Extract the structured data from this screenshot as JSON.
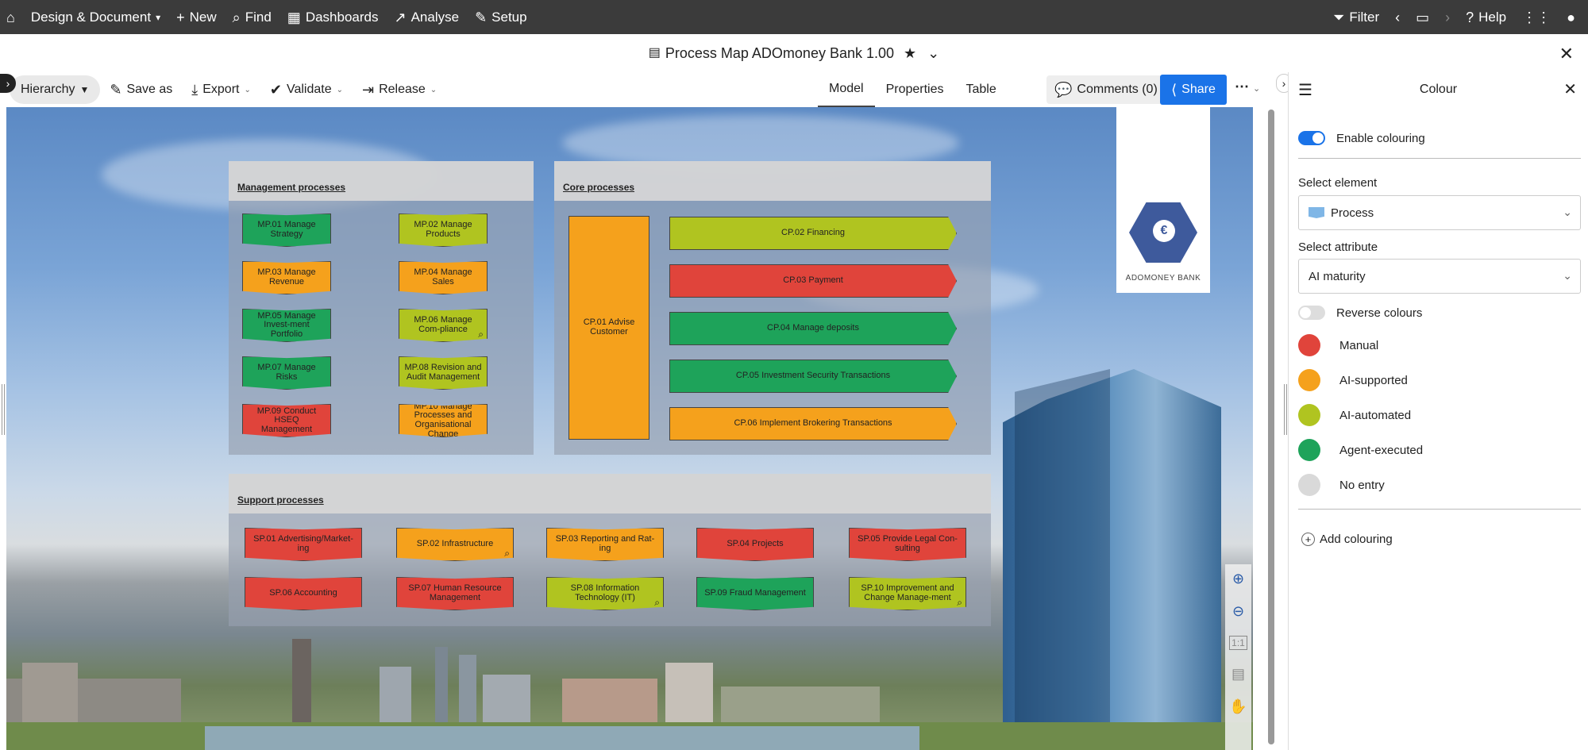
{
  "topbar": {
    "home_icon": "home-icon",
    "menu": [
      {
        "label": "Design & Document",
        "icon": "",
        "caret": true
      },
      {
        "label": "New",
        "icon": "plus-icon"
      },
      {
        "label": "Find",
        "icon": "search-icon"
      },
      {
        "label": "Dashboards",
        "icon": "dashboard-icon"
      },
      {
        "label": "Analyse",
        "icon": "chart-icon"
      },
      {
        "label": "Setup",
        "icon": "wrench-icon"
      }
    ],
    "right": {
      "filter": "Filter",
      "help": "Help"
    }
  },
  "title": {
    "text": "Process Map ADOmoney Bank 1.00"
  },
  "toolbar": {
    "hierarchy": "Hierarchy",
    "save_as": "Save as",
    "export": "Export",
    "validate": "Validate",
    "release": "Release",
    "views": [
      "Model",
      "Properties",
      "Table"
    ],
    "active_view": "Model",
    "comments": "Comments (0)",
    "share": "Share"
  },
  "model": {
    "logo_text": "ADOMONEY BANK",
    "management": {
      "title": "Management processes",
      "items": [
        {
          "label": "MP.01 Manage Strategy",
          "color": "g"
        },
        {
          "label": "MP.02 Manage Products",
          "color": "l"
        },
        {
          "label": "MP.03 Manage Revenue",
          "color": "o"
        },
        {
          "label": "MP.04 Manage Sales",
          "color": "o"
        },
        {
          "label": "MP.05 Manage Invest-ment Portfolio",
          "color": "g"
        },
        {
          "label": "MP.06 Manage Com-pliance",
          "color": "l"
        },
        {
          "label": "MP.07 Manage Risks",
          "color": "g"
        },
        {
          "label": "MP.08 Revision and Audit Management",
          "color": "l"
        },
        {
          "label": "MP.09 Conduct HSEQ Management",
          "color": "r"
        },
        {
          "label": "MP.10 Manage Processes and Organisational Change",
          "color": "o"
        }
      ]
    },
    "core": {
      "title": "Core processes",
      "advise": "CP.01 Advise Customer",
      "items": [
        {
          "label": "CP.02 Financing",
          "color": "l"
        },
        {
          "label": "CP.03 Payment",
          "color": "r"
        },
        {
          "label": "CP.04 Manage deposits",
          "color": "g"
        },
        {
          "label": "CP.05 Investment Security Transactions",
          "color": "g"
        },
        {
          "label": "CP.06 Implement Brokering Transactions",
          "color": "o"
        }
      ]
    },
    "support": {
      "title": "Support processes",
      "items": [
        {
          "label": "SP.01 Advertising/Market-ing",
          "color": "r"
        },
        {
          "label": "SP.02 Infrastructure",
          "color": "o"
        },
        {
          "label": "SP.03 Reporting and Rat-ing",
          "color": "o"
        },
        {
          "label": "SP.04 Projects",
          "color": "r"
        },
        {
          "label": "SP.05 Provide Legal Con-sulting",
          "color": "r"
        },
        {
          "label": "SP.06 Accounting",
          "color": "r"
        },
        {
          "label": "SP.07 Human Resource Management",
          "color": "r"
        },
        {
          "label": "SP.08 Information Technology (IT)",
          "color": "l"
        },
        {
          "label": "SP.09 Fraud Management",
          "color": "g"
        },
        {
          "label": "SP.10 Improvement and Change Manage-ment",
          "color": "l"
        }
      ]
    }
  },
  "panel": {
    "title": "Colour",
    "enable_colouring": "Enable colouring",
    "select_element_label": "Select element",
    "select_element_value": "Process",
    "select_attribute_label": "Select attribute",
    "select_attribute_value": "AI maturity",
    "reverse_colours": "Reverse colours",
    "legend": [
      {
        "label": "Manual",
        "color": "#e0443b"
      },
      {
        "label": "AI-supported",
        "color": "#f5a11c"
      },
      {
        "label": "AI-automated",
        "color": "#b0c420"
      },
      {
        "label": "Agent-executed",
        "color": "#1ea35a"
      },
      {
        "label": "No entry",
        "color": "#d9d9d9"
      }
    ],
    "add_colouring": "Add colouring"
  }
}
